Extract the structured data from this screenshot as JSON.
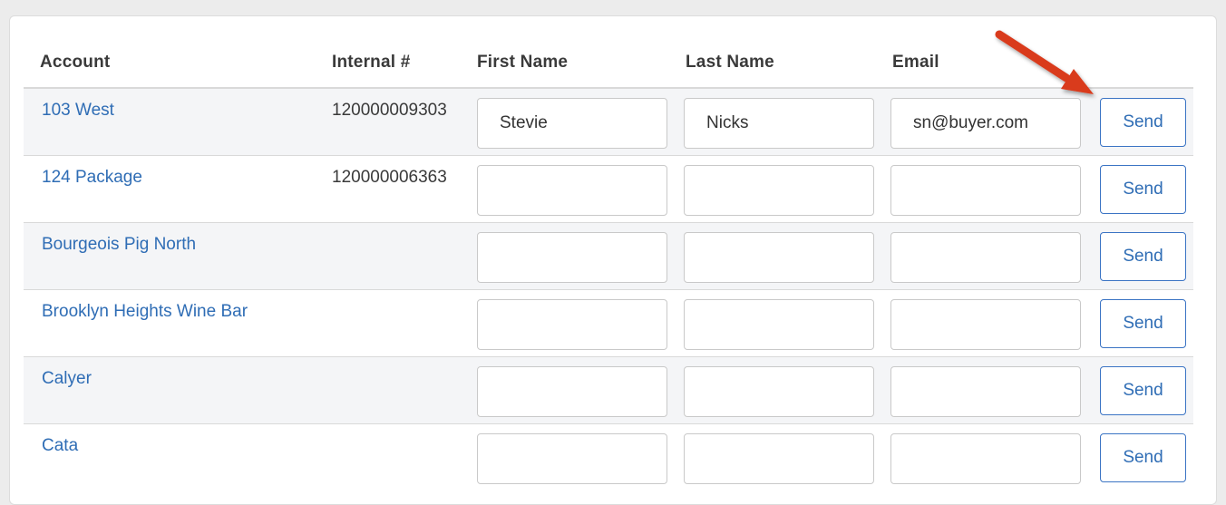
{
  "table": {
    "headers": {
      "account": "Account",
      "internal": "Internal #",
      "first_name": "First Name",
      "last_name": "Last Name",
      "email": "Email"
    },
    "rows": [
      {
        "account": "103 West",
        "internal": "120000009303",
        "first_name": "Stevie",
        "last_name": "Nicks",
        "email": "sn@buyer.com",
        "send_label": "Send"
      },
      {
        "account": "124 Package",
        "internal": "120000006363",
        "first_name": "",
        "last_name": "",
        "email": "",
        "send_label": "Send"
      },
      {
        "account": "Bourgeois Pig North",
        "internal": "",
        "first_name": "",
        "last_name": "",
        "email": "",
        "send_label": "Send"
      },
      {
        "account": "Brooklyn Heights Wine Bar",
        "internal": "",
        "first_name": "",
        "last_name": "",
        "email": "",
        "send_label": "Send"
      },
      {
        "account": "Calyer",
        "internal": "",
        "first_name": "",
        "last_name": "",
        "email": "",
        "send_label": "Send"
      },
      {
        "account": "Cata",
        "internal": "",
        "first_name": "",
        "last_name": "",
        "email": "",
        "send_label": "Send"
      }
    ]
  },
  "annotation": {
    "arrow_color": "#d93a1f",
    "arrow_icon": "red-pointer-arrow-icon"
  },
  "colors": {
    "link": "#2f6db5",
    "button_border": "#3b74c4",
    "row_alt_bg": "#f4f5f7"
  }
}
